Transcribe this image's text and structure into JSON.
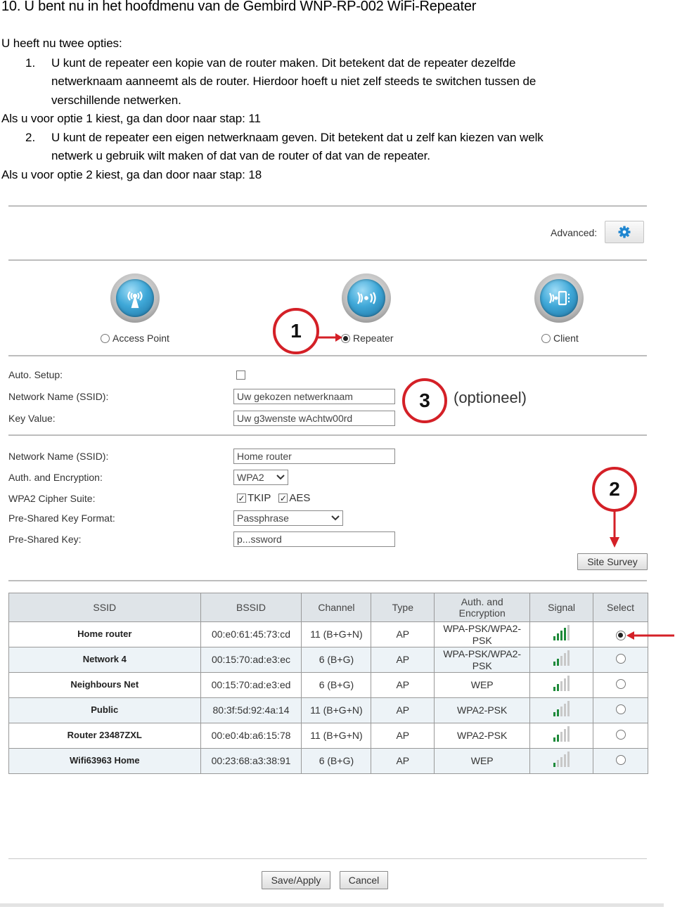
{
  "document": {
    "heading": "10. U bent nu in het hoofdmenu van de Gembird WNP-RP-002 WiFi-Repeater",
    "intro": "U heeft nu twee opties:",
    "option1": {
      "number": "1.",
      "line1": "U kunt de repeater een kopie van de router maken. Dit betekent dat de repeater dezelfde",
      "line2": "netwerknaam aanneemt als de router. Hierdoor hoeft u niet zelf steeds te switchen tussen de",
      "line3": "verschillende netwerken.",
      "followup": "Als u voor optie 1 kiest, ga dan door naar stap: 11"
    },
    "option2": {
      "number": "2.",
      "line1": "U kunt de repeater een eigen netwerknaam geven. Dit betekent dat u zelf kan kiezen van welk",
      "line2": "netwerk u gebruik wilt maken of dat van de router of dat van de repeater.",
      "followup": "Als u voor optie 2 kiest, ga dan door naar stap: 18"
    }
  },
  "screenshot": {
    "advanced": {
      "label": "Advanced:",
      "icon": "gear-icon",
      "accent": "#1f86d0"
    },
    "modes": [
      {
        "label": "Access Point",
        "icon": "antenna-icon",
        "selected": false
      },
      {
        "label": "Repeater",
        "icon": "repeater-waves-icon",
        "selected": true
      },
      {
        "label": "Client",
        "icon": "client-device-icon",
        "selected": false
      }
    ],
    "repeater_settings": {
      "auto_setup": {
        "label": "Auto. Setup:",
        "checked": false
      },
      "ssid": {
        "label": "Network Name (SSID):",
        "value": "Uw gekozen netwerknaam"
      },
      "key": {
        "label": "Key Value:",
        "value": "Uw g3wenste wAchtw00rd"
      }
    },
    "router_settings": {
      "ssid": {
        "label": "Network Name (SSID):",
        "value": "Home router"
      },
      "auth": {
        "label": "Auth. and Encryption:",
        "value": "WPA2"
      },
      "cipher": {
        "label": "WPA2 Cipher Suite:",
        "options": [
          {
            "label": "TKIP",
            "checked": true
          },
          {
            "label": "AES",
            "checked": true
          }
        ]
      },
      "psk_format": {
        "label": "Pre-Shared Key Format:",
        "value": "Passphrase"
      },
      "psk": {
        "label": "Pre-Shared Key:",
        "value": "p...ssword"
      }
    },
    "site_survey_label": "Site Survey",
    "table": {
      "headers": [
        "SSID",
        "BSSID",
        "Channel",
        "Type",
        "Auth. and Encryption",
        "Signal",
        "Select"
      ],
      "signal_max": 5,
      "rows": [
        {
          "ssid": "Home router",
          "bssid": "00:e0:61:45:73:cd",
          "channel": "11 (B+G+N)",
          "type": "AP",
          "auth": "WPA-PSK/WPA2-PSK",
          "signal": 4,
          "selected": true
        },
        {
          "ssid": "Network 4",
          "bssid": "00:15:70:ad:e3:ec",
          "channel": "6 (B+G)",
          "type": "AP",
          "auth": "WPA-PSK/WPA2-PSK",
          "signal": 2,
          "selected": false
        },
        {
          "ssid": "Neighbours Net",
          "bssid": "00:15:70:ad:e3:ed",
          "channel": "6 (B+G)",
          "type": "AP",
          "auth": "WEP",
          "signal": 2,
          "selected": false
        },
        {
          "ssid": "Public",
          "bssid": "80:3f:5d:92:4a:14",
          "channel": "11 (B+G+N)",
          "type": "AP",
          "auth": "WPA2-PSK",
          "signal": 2,
          "selected": false
        },
        {
          "ssid": "Router 23487ZXL",
          "bssid": "00:e0:4b:a6:15:78",
          "channel": "11 (B+G+N)",
          "type": "AP",
          "auth": "WPA2-PSK",
          "signal": 2,
          "selected": false
        },
        {
          "ssid": "Wifi63963 Home",
          "bssid": "00:23:68:a3:38:91",
          "channel": "6 (B+G)",
          "type": "AP",
          "auth": "WEP",
          "signal": 1,
          "selected": false
        }
      ]
    },
    "buttons": {
      "save": "Save/Apply",
      "cancel": "Cancel"
    },
    "annotations": {
      "step1": "1",
      "step2": "2",
      "step3": "3",
      "step3_note": "(optioneel)",
      "color": "#d42027"
    }
  }
}
